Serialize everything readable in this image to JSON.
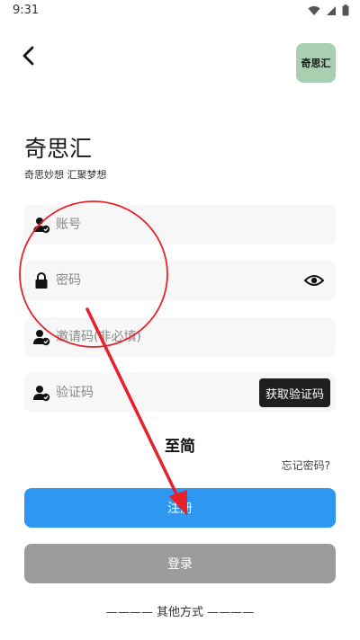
{
  "status_bar": {
    "time": "9:31"
  },
  "header": {
    "app_badge": "奇思汇"
  },
  "title": "奇思汇",
  "subtitle": "奇思妙想  汇聚梦想",
  "fields": {
    "account": {
      "placeholder": "账号",
      "icon": "user-check-icon"
    },
    "password": {
      "placeholder": "密码",
      "icon": "lock-icon",
      "toggle_icon": "eye-icon"
    },
    "invite": {
      "placeholder": "邀请码(非必填)",
      "icon": "user-check-icon"
    },
    "code": {
      "placeholder": "验证码",
      "icon": "user-check-icon",
      "button_label": "获取验证码"
    }
  },
  "brand_text": "至简",
  "forgot_password": "忘记密码?",
  "register_button": "注册",
  "login_button": "登录",
  "other_methods": "———— 其他方式 ————",
  "colors": {
    "primary": "#2d97f2",
    "secondary": "#9b9b9b",
    "badge": "#a8cfb0",
    "annotation": "#e8202a"
  }
}
